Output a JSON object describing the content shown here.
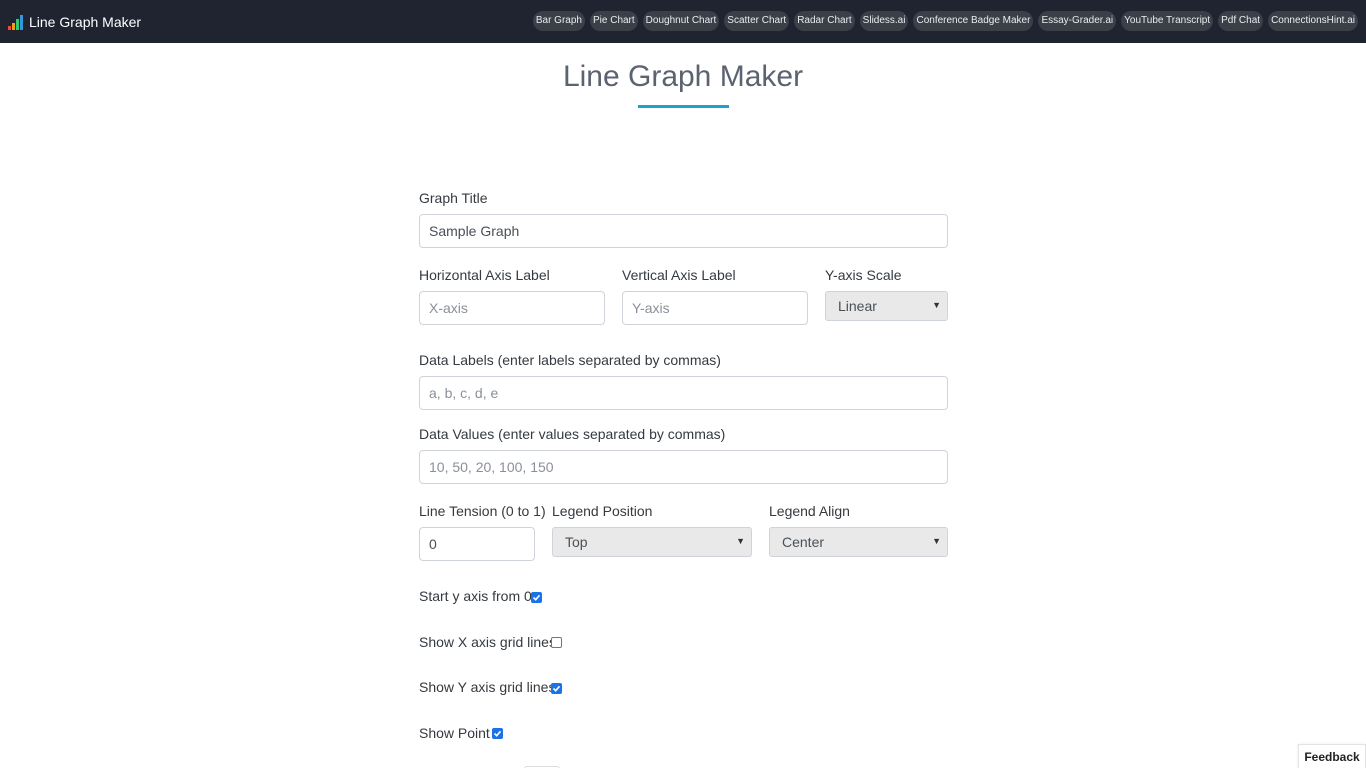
{
  "navbar": {
    "brand": "Line Graph Maker",
    "links": [
      "Bar Graph",
      "Pie Chart",
      "Doughnut Chart",
      "Scatter Chart",
      "Radar Chart",
      "Slidess.ai",
      "Conference Badge Maker",
      "Essay-Grader.ai",
      "YouTube Transcript",
      "Pdf Chat",
      "ConnectionsHint.ai"
    ]
  },
  "page": {
    "title": "Line Graph Maker"
  },
  "form": {
    "graph_title": {
      "label": "Graph Title",
      "value": "Sample Graph"
    },
    "x_axis_label": {
      "label": "Horizontal Axis Label",
      "placeholder": "X-axis"
    },
    "y_axis_label": {
      "label": "Vertical Axis Label",
      "placeholder": "Y-axis"
    },
    "y_axis_scale": {
      "label": "Y-axis Scale",
      "selected": "Linear"
    },
    "data_labels": {
      "label": "Data Labels (enter labels separated by commas)",
      "placeholder": "a, b, c, d, e"
    },
    "data_values": {
      "label": "Data Values (enter values separated by commas)",
      "placeholder": "10, 50, 20, 100, 150"
    },
    "line_tension": {
      "label": "Line Tension (0 to 1)",
      "value": "0"
    },
    "legend_position": {
      "label": "Legend Position",
      "selected": "Top"
    },
    "legend_align": {
      "label": "Legend Align",
      "selected": "Center"
    },
    "start_y_zero": {
      "label": "Start y axis from 0",
      "checked": true
    },
    "show_x_grid": {
      "label": "Show X axis grid lines",
      "checked": false
    },
    "show_y_grid": {
      "label": "Show Y axis grid lines",
      "checked": true
    },
    "show_point": {
      "label": "Show Point",
      "checked": true
    }
  },
  "feedback_label": "Feedback",
  "colors": {
    "navbar": "#1f2430",
    "accent": "#1fa2c9",
    "checkbox": "#1a73e8"
  }
}
